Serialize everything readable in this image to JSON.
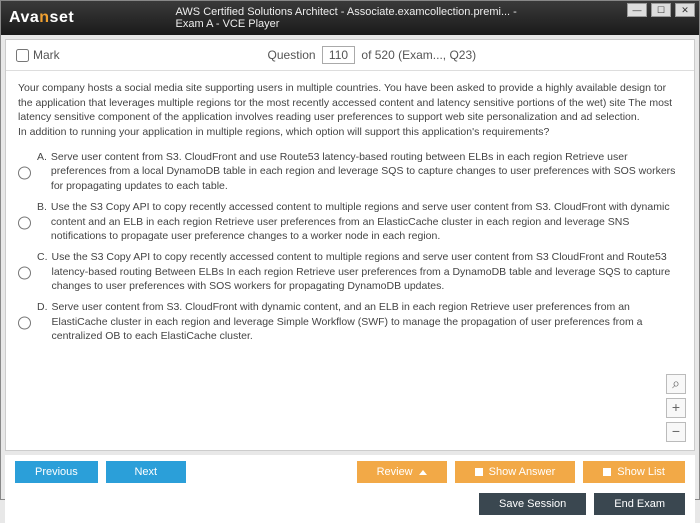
{
  "window": {
    "logo_pre": "Ava",
    "logo_n": "n",
    "logo_post": "set",
    "title": "AWS Certified Solutions Architect - Associate.examcollection.premi... - Exam A - VCE Player"
  },
  "header": {
    "mark": "Mark",
    "question_label": "Question",
    "current": "110",
    "of_label": "of 520 (Exam..., Q23)"
  },
  "question": {
    "text1": "Your company hosts a social media site supporting users in multiple countries. You have been asked to provide a highly available design tor the application that leverages multiple regions tor the most recently accessed content and latency sensitive portions of the wet) site The most latency sensitive component of the application involves reading user preferences to support web site personalization and ad selection.",
    "text2": "In addition to running your application in multiple regions, which option will support this application's requirements?"
  },
  "options": [
    {
      "label": "A.",
      "text": "Serve user content from S3. CloudFront and use Route53 latency-based routing between ELBs in each region Retrieve user preferences from a local DynamoDB table in each region and leverage SQS to capture changes to user preferences with SOS workers for propagating updates to each table."
    },
    {
      "label": "B.",
      "text": "Use the S3 Copy API to copy recently accessed content to multiple regions and serve user content from S3. CloudFront with dynamic content and an ELB in each region Retrieve user preferences from an ElasticCache cluster in each region and leverage SNS notifications to propagate user preference changes to a worker node in each region."
    },
    {
      "label": "C.",
      "text": "Use the S3 Copy API to copy recently accessed content to multiple regions and serve user content from S3 CloudFront and Route53 latency-based routing Between ELBs In each region Retrieve user preferences from a DynamoDB table and leverage SQS to capture changes to user preferences with SOS workers for propagating DynamoDB updates."
    },
    {
      "label": "D.",
      "text": "Serve user content from S3. CloudFront with dynamic content, and an ELB in each region Retrieve user preferences from an ElastiCache cluster in each region and leverage Simple Workflow (SWF) to manage the propagation of user preferences from a centralized OB to each ElastiCache cluster."
    }
  ],
  "buttons": {
    "previous": "Previous",
    "next": "Next",
    "review": "Review",
    "show_answer": "Show Answer",
    "show_list": "Show List",
    "save_session": "Save Session",
    "end_exam": "End Exam"
  }
}
